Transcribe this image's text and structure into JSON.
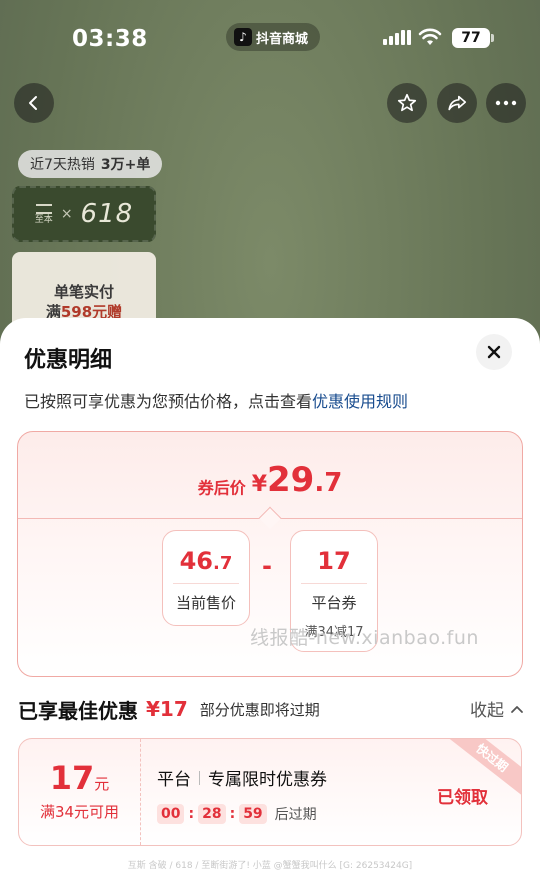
{
  "status_bar": {
    "time": "03:38",
    "app_pill": "抖音商城",
    "app_logo": "♪",
    "battery": "77"
  },
  "product": {
    "sales_badge_prefix": "近7天热销",
    "sales_badge_value": "3万+单",
    "tag_mini_top": "至本",
    "tag_x": "×",
    "tag_number": "618",
    "promo_line1": "单笔实付",
    "promo_line2_prefix": "满",
    "promo_line2_amount": "598元赠"
  },
  "sheet": {
    "title": "优惠明细",
    "desc_text": "已按照可享优惠为您预估价格，点击查看",
    "desc_link": "优惠使用规则",
    "final_price_label": "券后价",
    "final_price_currency": "¥",
    "final_price_int": "29",
    "final_price_dec": ".7",
    "current_price_int": "46",
    "current_price_dec": ".7",
    "current_price_label": "当前售价",
    "minus_sign": "-",
    "platform_coupon_value": "17",
    "platform_coupon_label": "平台券",
    "platform_coupon_condition": "满34减17",
    "watermark": "线报酷-new.xianbao.fun"
  },
  "best_discount": {
    "title": "已享最佳优惠",
    "amount": "¥17",
    "note": "部分优惠即将过期",
    "collapse_label": "收起"
  },
  "coupon": {
    "amount": "17",
    "unit": "元",
    "condition": "满34元可用",
    "source": "平台",
    "name": "专属限时优惠券",
    "countdown_h": "00",
    "countdown_m": "28",
    "countdown_s": "59",
    "countdown_suffix": "后过期",
    "status": "已领取",
    "ribbon": "快过期"
  },
  "footer_watermark": "互斯 含破 / 618 / 至断街游了! 小蓝 @蟹蟹我叫什么 [G: 26253424G]",
  "colors": {
    "accent_red": "#e2303a",
    "link_blue": "#1a4d8f",
    "bg_olive": "#6d7a5c"
  }
}
